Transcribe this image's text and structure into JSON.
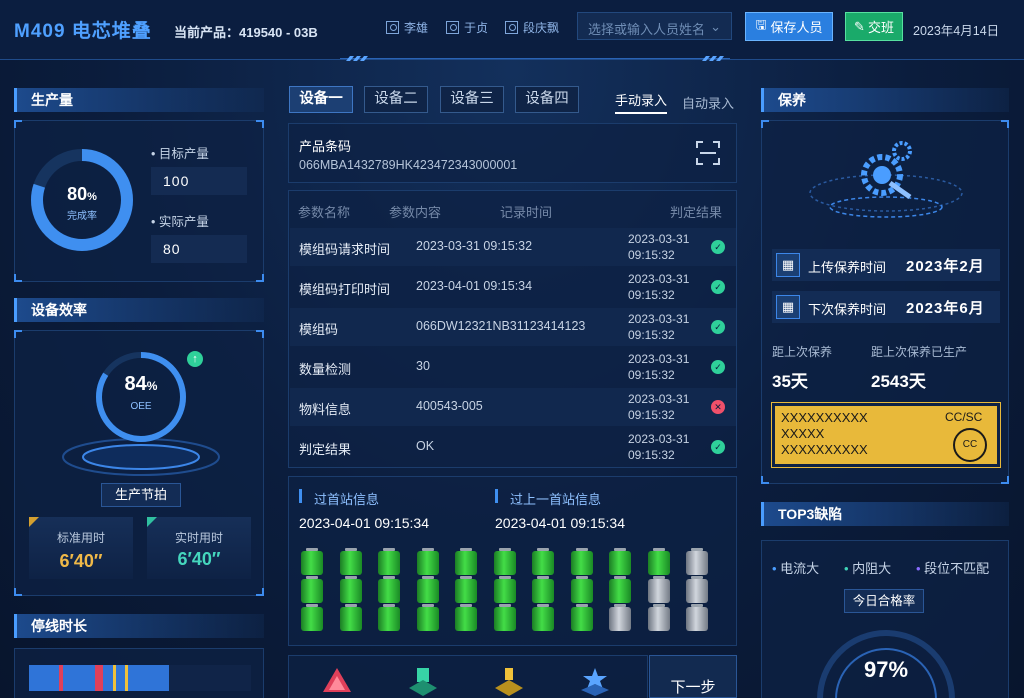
{
  "header": {
    "title": "M409 电芯堆叠",
    "product": "当前产品：419540 - 03B",
    "persons": [
      "李雄",
      "于贞",
      "段庆飘"
    ],
    "person_select_placeholder": "选择或输入人员姓名",
    "save_button": "保存人员",
    "shift_button": "交班",
    "date": "2023年4月14日"
  },
  "production": {
    "title": "生产量",
    "rate_value": "80",
    "rate_unit": "%",
    "rate_label": "完成率",
    "rate_fraction": 0.8,
    "target_label": "目标产量",
    "target_value": "100",
    "actual_label": "实际产量",
    "actual_value": "80"
  },
  "efficiency": {
    "title": "设备效率",
    "oee_value": "84",
    "oee_unit": "%",
    "oee_label": "OEE",
    "oee_fraction": 0.84,
    "beat_label": "生产节拍",
    "std_time_label": "标准用时",
    "std_time_value": "6′40″",
    "real_time_label": "实时用时",
    "real_time_value": "6′40″"
  },
  "downtime": {
    "title": "停线时长"
  },
  "tabs": [
    "设备一",
    "设备二",
    "设备三",
    "设备四"
  ],
  "entry_modes": {
    "manual": "手动录入",
    "auto": "自动录入"
  },
  "barcode": {
    "label": "产品条码",
    "value": "066MBA1432789HK423472343000001"
  },
  "table": {
    "headers": [
      "参数名称",
      "参数内容",
      "记录时间",
      "判定结果"
    ],
    "rows": [
      {
        "name": "模组码请求时间",
        "content": "2023-03-31  09:15:32",
        "time_date": "2023-03-31",
        "time_clock": "09:15:32",
        "result": "ok"
      },
      {
        "name": "模组码打印时间",
        "content": "2023-04-01 09:15:34",
        "time_date": "2023-03-31",
        "time_clock": "09:15:32",
        "result": "ok"
      },
      {
        "name": "模组码",
        "content": "066DW12321NB31123414123",
        "time_date": "2023-03-31",
        "time_clock": "09:15:32",
        "result": "ok"
      },
      {
        "name": "数量检测",
        "content": "30",
        "time_date": "2023-03-31",
        "time_clock": "09:15:32",
        "result": "ok"
      },
      {
        "name": "物料信息",
        "content": "400543-005",
        "time_date": "2023-03-31",
        "time_clock": "09:15:32",
        "result": "ng"
      },
      {
        "name": "判定结果",
        "content": "OK",
        "time_date": "2023-03-31",
        "time_clock": "09:15:32",
        "result": "ok"
      }
    ]
  },
  "station": {
    "first_label": "过首站信息",
    "first_time": "2023-04-01 09:15:34",
    "prev_label": "过上一首站信息",
    "prev_time": "2023-04-01 09:15:34",
    "battery_grid": [
      [
        "g",
        "g",
        "g",
        "g",
        "g",
        "g",
        "g",
        "g",
        "g",
        "g",
        "s"
      ],
      [
        "g",
        "g",
        "g",
        "g",
        "g",
        "g",
        "g",
        "g",
        "g",
        "s",
        "s"
      ],
      [
        "g",
        "g",
        "g",
        "g",
        "g",
        "g",
        "g",
        "g",
        "s",
        "s",
        "s"
      ]
    ]
  },
  "next_button": "下一步",
  "maintenance": {
    "title": "保养",
    "upload_label": "上传保养时间",
    "upload_value": "2023年2月",
    "next_label": "下次保养时间",
    "next_value": "2023年6月",
    "since_label": "距上次保养",
    "since_value": "35天",
    "produced_label": "距上次保养已生产",
    "produced_value": "2543天",
    "card_line1": "XXXXXXXXXX",
    "card_line2": "XXXXX",
    "card_line3": "XXXXXXXXXX",
    "card_code": "CC/SC",
    "card_stamp": "CC"
  },
  "defects": {
    "title": "TOP3缺陷",
    "items": [
      "电流大",
      "内阻大",
      "段位不匹配"
    ],
    "pass_rate_label": "今日合格率",
    "pass_rate_value": "97%"
  },
  "colors": {
    "accent": "#4a9dff",
    "ok": "#2fd09a",
    "ng": "#f0506a",
    "gold": "#f0c13a",
    "teal": "#3fd4b8"
  }
}
